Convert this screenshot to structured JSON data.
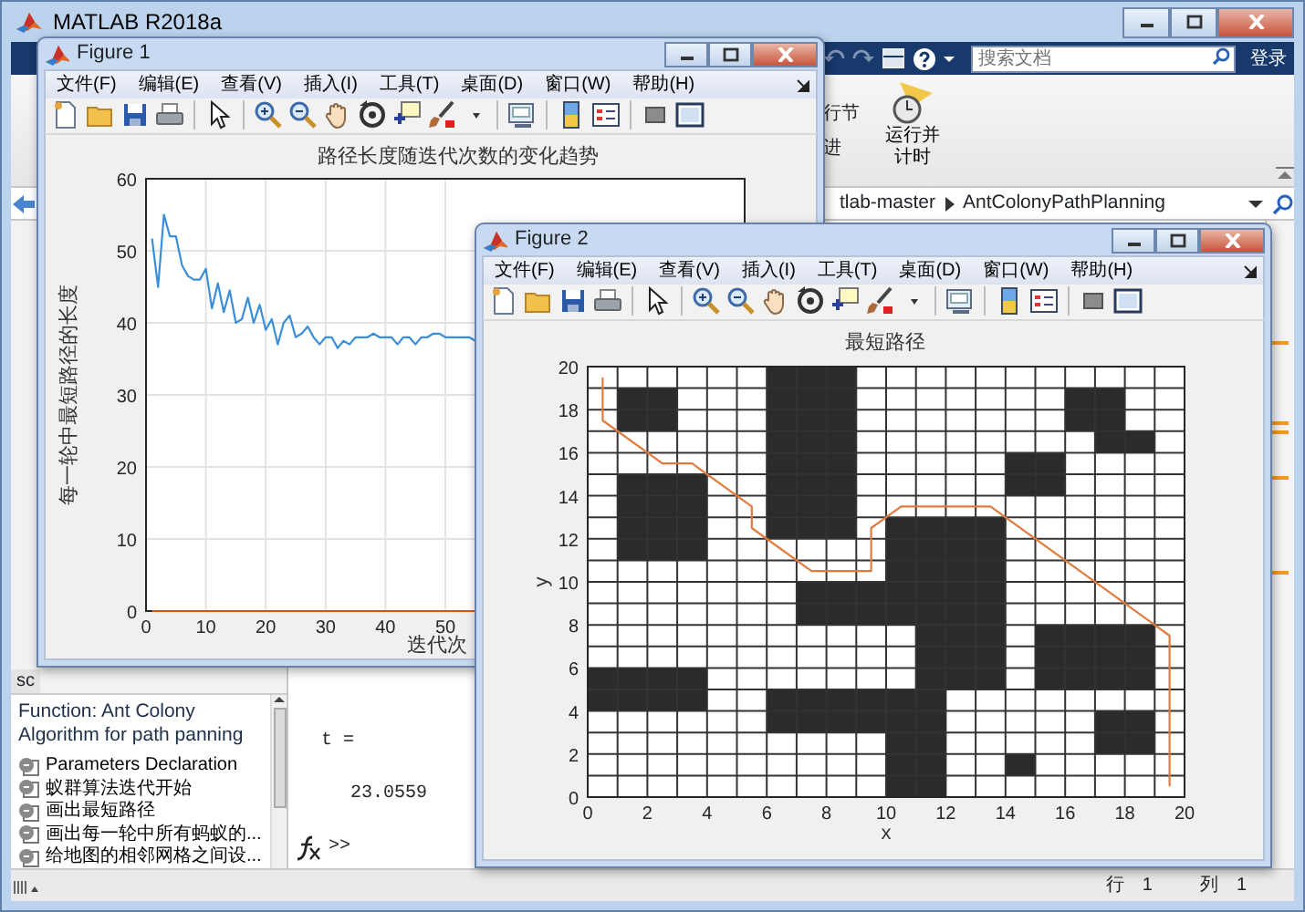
{
  "main_window": {
    "title": "MATLAB R2018a",
    "search": {
      "placeholder": "搜索文档"
    },
    "login_button": "登录",
    "ribbon": {
      "run_section": "行节",
      "advance": "进",
      "run_and_time": [
        "运行并",
        "计时"
      ]
    },
    "path": [
      "tlab-master",
      "AntColonyPathPlanning"
    ],
    "side_tab": "sc",
    "outline": {
      "heading": "Function: Ant Colony Algorithm for path panning",
      "items": [
        "Parameters Declaration",
        "蚁群算法迭代开始",
        "画出最短路径",
        "画出每一轮中所有蚂蚁的...",
        "给地图的相邻网格之间设..."
      ]
    },
    "command_window": {
      "lines": [
        "t =",
        "23.0559"
      ],
      "prompt": ">>"
    },
    "status_bar": {
      "row_label": "行",
      "row": "1",
      "col_label": "列",
      "col": "1"
    }
  },
  "figures": [
    {
      "title": "Figure 1",
      "menu": [
        "文件(F)",
        "编辑(E)",
        "查看(V)",
        "插入(I)",
        "工具(T)",
        "桌面(D)",
        "窗口(W)",
        "帮助(H)"
      ],
      "chart_data": {
        "type": "line",
        "title": "路径长度随迭代次数的变化趋势",
        "xlabel": "迭代次",
        "ylabel": "每一轮中最短路径的长度",
        "grid": true,
        "xlim": [
          0,
          100
        ],
        "ylim": [
          0,
          60
        ],
        "xticks": [
          0,
          10,
          20,
          30,
          40,
          50
        ],
        "yticks": [
          0,
          10,
          20,
          30,
          40,
          50,
          60
        ],
        "x": [
          1,
          2,
          3,
          4,
          5,
          6,
          7,
          8,
          9,
          10,
          11,
          12,
          13,
          14,
          15,
          16,
          17,
          18,
          19,
          20,
          21,
          22,
          23,
          24,
          25,
          26,
          27,
          28,
          29,
          30,
          31,
          32,
          33,
          34,
          35,
          36,
          37,
          38,
          39,
          40,
          41,
          42,
          43,
          44,
          45,
          46,
          47,
          48,
          49,
          50,
          51,
          52,
          53,
          54,
          55,
          56
        ],
        "series": [
          {
            "color": "#3a8fd8",
            "values": [
              51.7,
              45,
              55,
              52,
              52,
              48,
              46.5,
              46,
              46,
              47.5,
              42,
              45.5,
              41.5,
              44.5,
              40,
              40.5,
              43.5,
              40,
              42.5,
              39,
              40.5,
              37,
              40,
              41,
              38,
              38.5,
              39.5,
              38,
              37,
              38,
              38,
              36.5,
              37.5,
              37,
              38,
              38,
              38,
              38.5,
              38,
              38,
              38,
              37,
              38,
              38,
              37,
              38,
              38,
              38.5,
              38.5,
              38,
              38,
              38,
              38,
              38,
              37.5,
              37
            ]
          },
          {
            "color": "#d95319",
            "values": [
              0,
              0,
              0,
              0,
              0,
              0,
              0,
              0,
              0,
              0,
              0,
              0,
              0,
              0,
              0,
              0,
              0,
              0,
              0,
              0,
              0,
              0,
              0,
              0,
              0,
              0,
              0,
              0,
              0,
              0,
              0,
              0,
              0,
              0,
              0,
              0,
              0,
              0,
              0,
              0,
              0,
              0,
              0,
              0,
              0,
              0,
              0,
              0,
              0,
              0,
              0,
              0,
              0,
              0,
              0,
              0
            ]
          }
        ]
      }
    },
    {
      "title": "Figure 2",
      "menu": [
        "文件(F)",
        "编辑(E)",
        "查看(V)",
        "插入(I)",
        "工具(T)",
        "桌面(D)",
        "窗口(W)",
        "帮助(H)"
      ],
      "chart_data": {
        "type": "line",
        "title": "最短路径",
        "xlabel": "x",
        "ylabel": "y",
        "grid": true,
        "xlim": [
          0,
          20
        ],
        "ylim": [
          0,
          20
        ],
        "xticks": [
          0,
          2,
          4,
          6,
          8,
          10,
          12,
          14,
          16,
          18,
          20
        ],
        "yticks": [
          0,
          2,
          4,
          6,
          8,
          10,
          12,
          14,
          16,
          18,
          20
        ],
        "x": [
          0.5,
          0.5,
          2.5,
          3.5,
          5.5,
          5.5,
          7.5,
          9.5,
          9.5,
          10.5,
          13.5,
          19,
          19.5,
          19.5
        ],
        "series": [
          {
            "color": "#e07b40",
            "values": [
              19.5,
              17.5,
              15.5,
              15.5,
              13.5,
              12.5,
              10.5,
              10.5,
              12.5,
              13.5,
              13.5,
              8,
              7.5,
              0.5
            ]
          }
        ]
      }
    }
  ]
}
